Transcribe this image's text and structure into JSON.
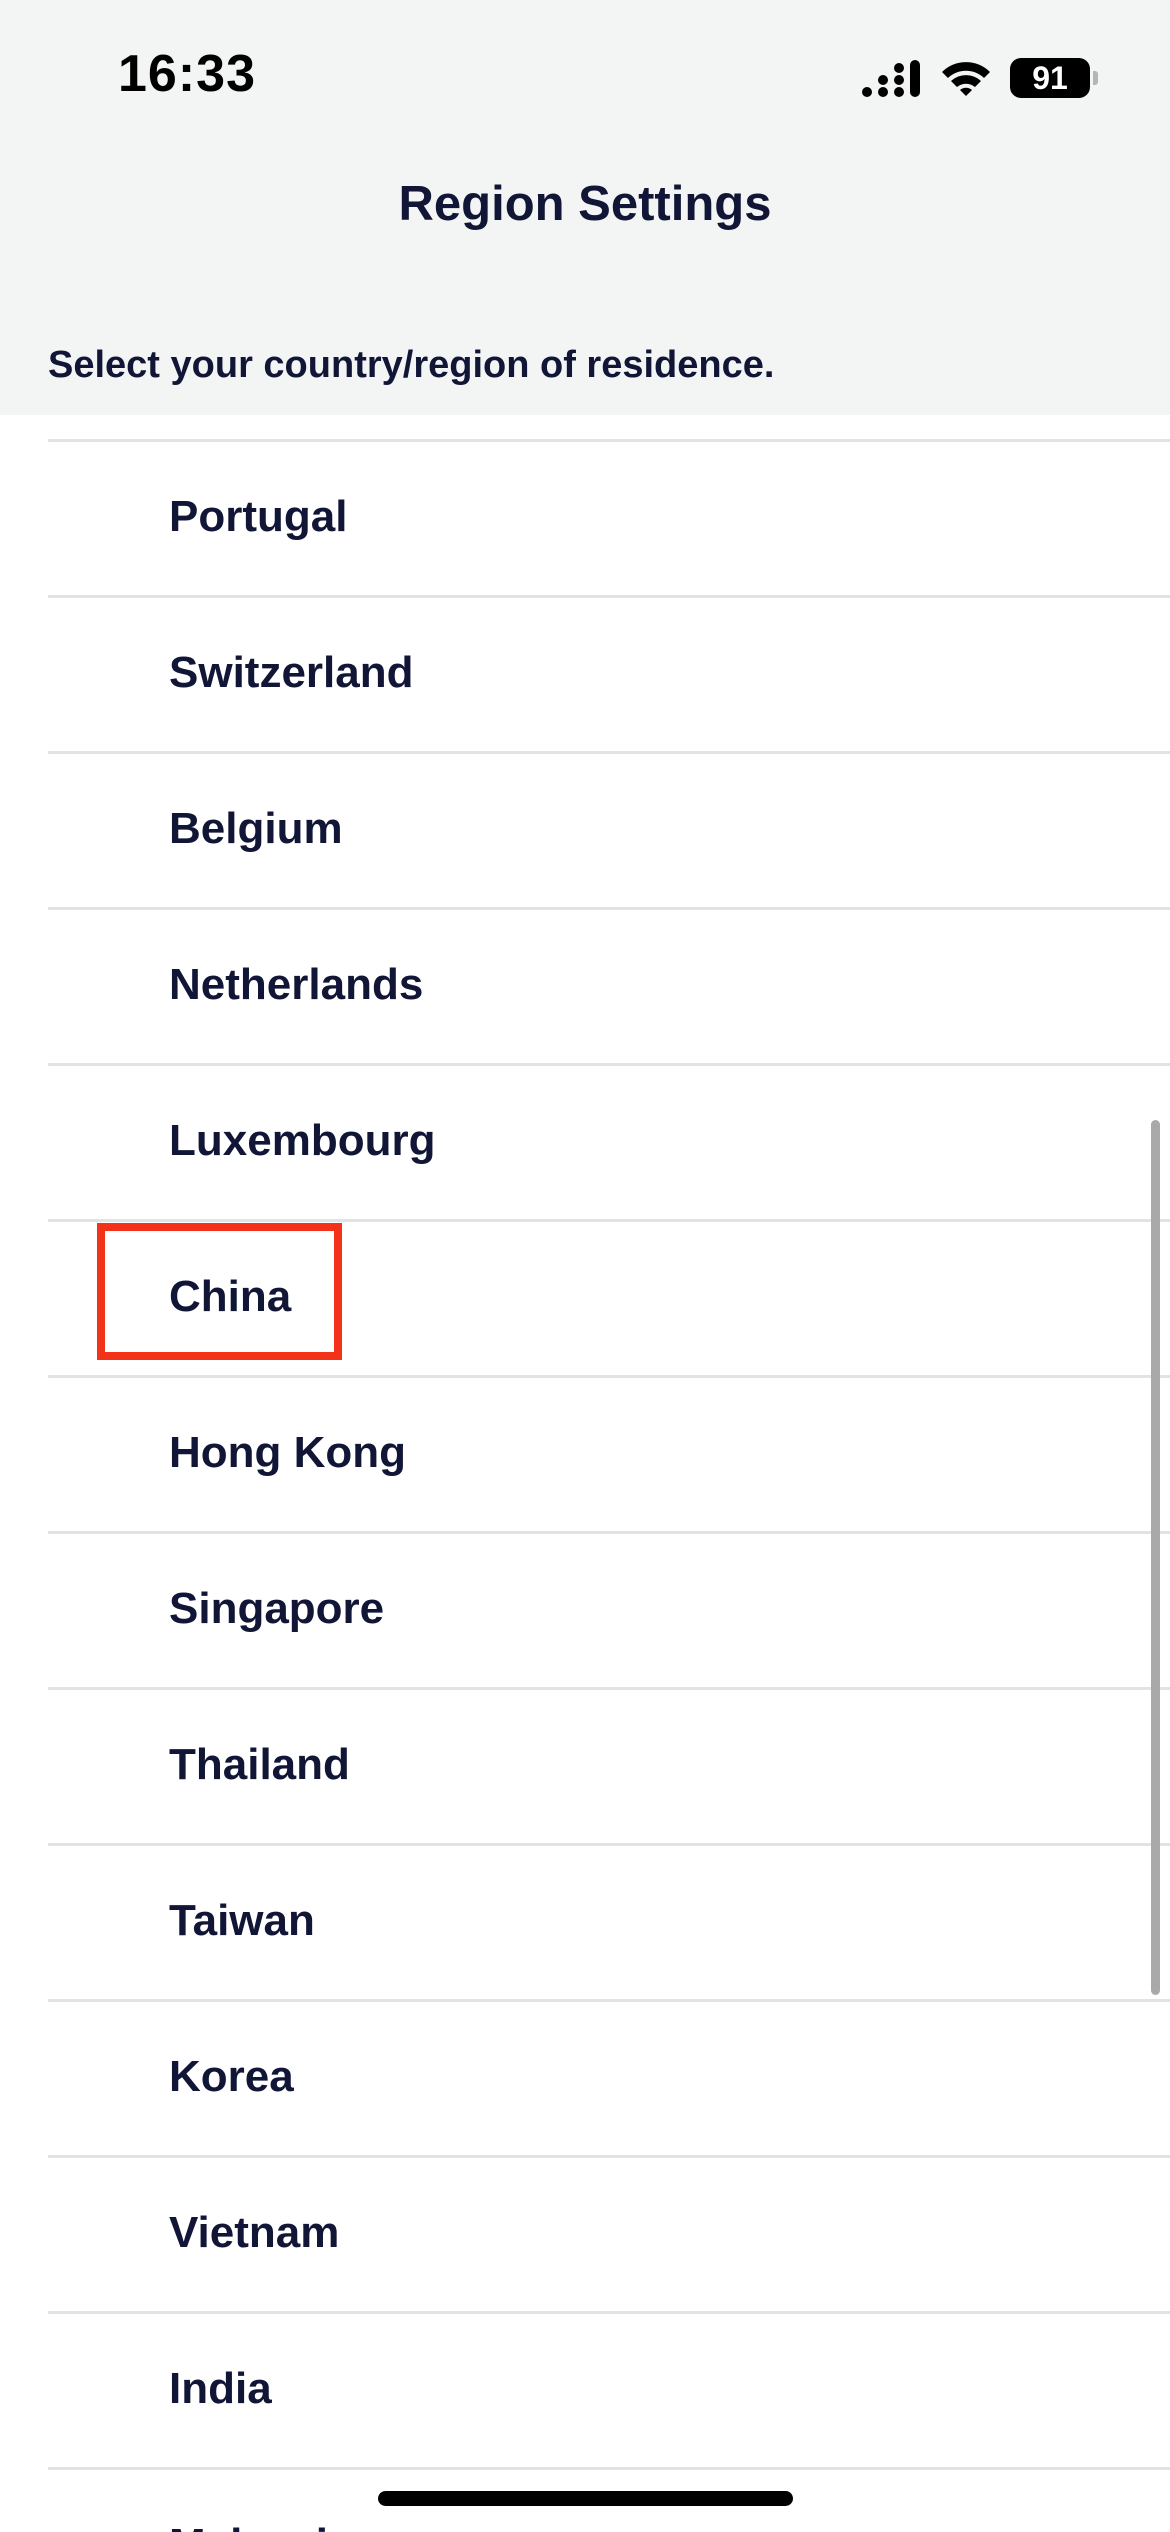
{
  "status_bar": {
    "time": "16:33",
    "battery": "91"
  },
  "header": {
    "title": "Region Settings",
    "subtitle": "Select your country/region of residence."
  },
  "regions": [
    "Portugal",
    "Switzerland",
    "Belgium",
    "Netherlands",
    "Luxembourg",
    "China",
    "Hong Kong",
    "Singapore",
    "Thailand",
    "Taiwan",
    "Korea",
    "Vietnam",
    "India",
    "Malaysia"
  ],
  "highlighted_region": "China",
  "colors": {
    "header_bg": "#f3f4f4",
    "text": "#111636",
    "divider": "#e2e3e5",
    "highlight": "#f2331a"
  }
}
